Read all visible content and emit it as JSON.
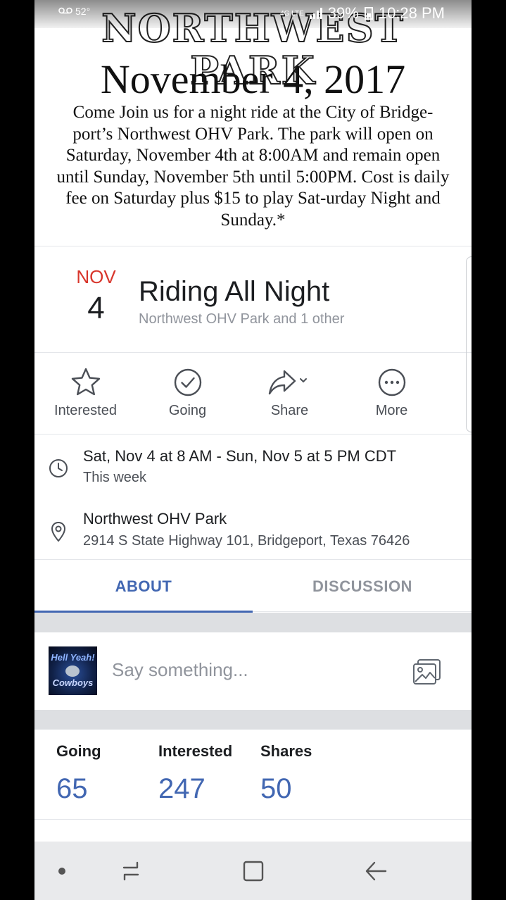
{
  "status_bar": {
    "voicemail_icon": "voicemail-icon",
    "temperature": "52°",
    "network": "4G LTE",
    "battery": "39%",
    "time": "10:28 PM"
  },
  "cover": {
    "park_title": "NORTHWEST PARK",
    "date": "November 4, 2017",
    "description": "Come Join us for a night ride at the City of Bridge-port’s Northwest OHV Park.  The park will open on Saturday, November 4th at 8:00AM and remain open until Sunday, November 5th until 5:00PM. Cost is daily fee on Saturday plus $15 to play Sat-urday Night and Sunday.*"
  },
  "event": {
    "month": "NOV",
    "day": "4",
    "title": "Riding All Night",
    "subtitle": "Northwest OHV Park and 1 other"
  },
  "actions": [
    {
      "label": "Interested",
      "icon": "star-icon"
    },
    {
      "label": "Going",
      "icon": "check-circle-icon"
    },
    {
      "label": "Share",
      "icon": "share-arrow-icon"
    },
    {
      "label": "More",
      "icon": "more-dots-icon"
    }
  ],
  "details": {
    "time_main": "Sat, Nov 4 at 8 AM - Sun, Nov 5 at 5 PM CDT",
    "time_sub": "This week",
    "place_main": "Northwest OHV Park",
    "place_sub": "2914 S State Highway 101, Bridgeport, Texas 76426"
  },
  "tabs": {
    "about": "ABOUT",
    "discussion": "DISCUSSION"
  },
  "composer": {
    "placeholder": "Say something...",
    "avatar_text_top": "Hell Yeah!",
    "avatar_text_bottom": "Cowboys"
  },
  "stats": [
    {
      "label": "Going",
      "value": "65"
    },
    {
      "label": "Interested",
      "value": "247"
    },
    {
      "label": "Shares",
      "value": "50"
    }
  ],
  "colors": {
    "accent": "#4267b2",
    "month_red": "#d8362c",
    "text_primary": "#1c1e21",
    "text_secondary": "#90949c"
  }
}
